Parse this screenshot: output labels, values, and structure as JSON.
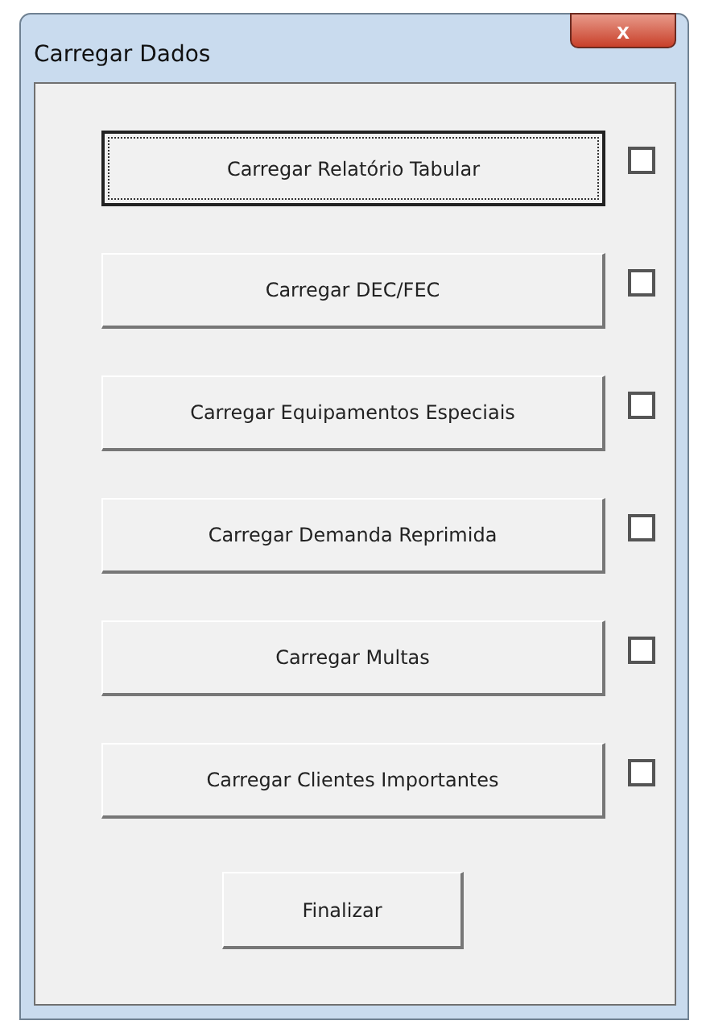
{
  "window": {
    "title": "Carregar Dados",
    "close_icon": "x"
  },
  "rows": [
    {
      "label": "Carregar Relatório Tabular",
      "focused": true,
      "checked": false
    },
    {
      "label": "Carregar DEC/FEC",
      "focused": false,
      "checked": false
    },
    {
      "label": "Carregar Equipamentos Especiais",
      "focused": false,
      "checked": false
    },
    {
      "label": "Carregar Demanda Reprimida",
      "focused": false,
      "checked": false
    },
    {
      "label": "Carregar Multas",
      "focused": false,
      "checked": false
    },
    {
      "label": "Carregar Clientes Importantes",
      "focused": false,
      "checked": false
    }
  ],
  "finish_button": "Finalizar"
}
